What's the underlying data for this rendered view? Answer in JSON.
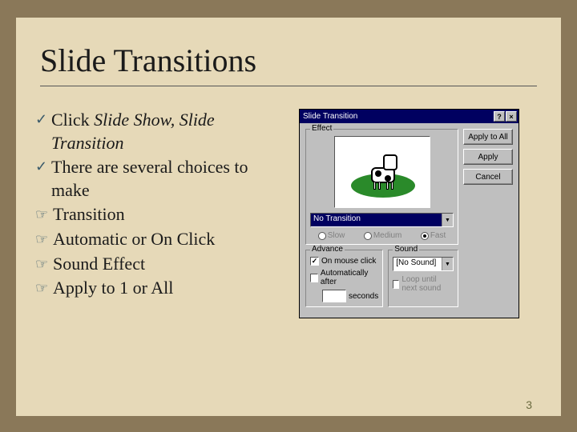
{
  "title": "Slide Transitions",
  "bullets": {
    "b1a": "Click ",
    "b1b": "Slide Show, Slide Transition",
    "b2": "There are several choices to make",
    "s1": "Transition",
    "s2": "Automatic or On Click",
    "s3": "Sound Effect",
    "s4": "Apply to 1 or All"
  },
  "dialog": {
    "title": "Slide Transition",
    "buttons": {
      "applyAll": "Apply to All",
      "apply": "Apply",
      "cancel": "Cancel"
    },
    "effect": {
      "label": "Effect",
      "selected": "No Transition",
      "speed": {
        "slow": "Slow",
        "medium": "Medium",
        "fast": "Fast"
      }
    },
    "advance": {
      "label": "Advance",
      "onClick": "On mouse click",
      "auto": "Automatically after",
      "secondsLabel": "seconds"
    },
    "sound": {
      "label": "Sound",
      "selected": "[No Sound]",
      "loop": "Loop until next sound"
    }
  },
  "pageNum": "3"
}
